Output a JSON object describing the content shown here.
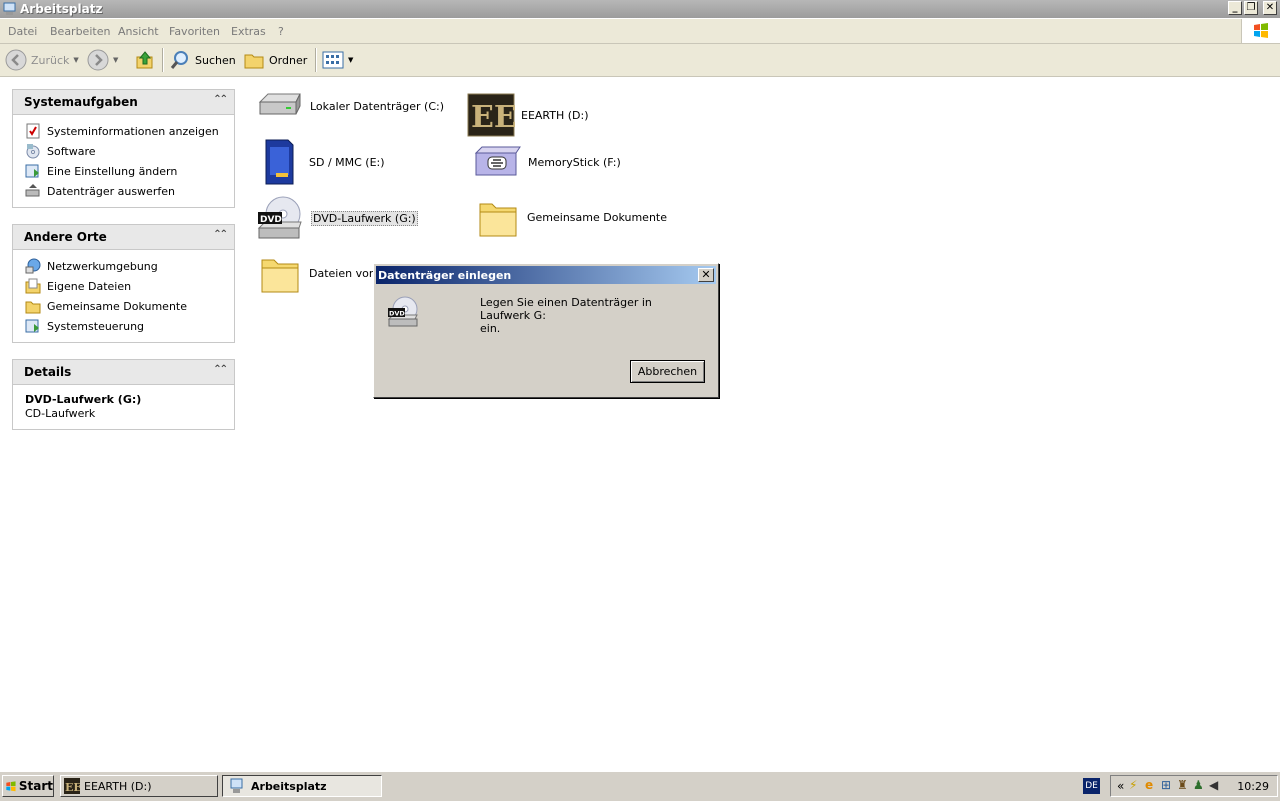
{
  "window": {
    "title": "Arbeitsplatz",
    "caption_buttons": [
      "minimize",
      "restore",
      "close"
    ]
  },
  "menubar": {
    "items": [
      "Datei",
      "Bearbeiten",
      "Ansicht",
      "Favoriten",
      "Extras",
      "?"
    ]
  },
  "toolbar": {
    "back_label": "Zurück",
    "search_label": "Suchen",
    "folders_label": "Ordner"
  },
  "left_pane": {
    "system_tasks": {
      "title": "Systemaufgaben",
      "items": [
        "Systeminformationen anzeigen",
        "Software",
        "Eine Einstellung ändern",
        "Datenträger auswerfen"
      ]
    },
    "other_places": {
      "title": "Andere Orte",
      "items": [
        "Netzwerkumgebung",
        "Eigene Dateien",
        "Gemeinsame Dokumente",
        "Systemsteuerung"
      ]
    },
    "details": {
      "title": "Details",
      "name": "DVD-Laufwerk (G:)",
      "type": "CD-Laufwerk"
    }
  },
  "drives": {
    "c": "Lokaler Datenträger (C:)",
    "d": "EEARTH (D:)",
    "e": "SD / MMC (E:)",
    "f": "MemoryStick (F:)",
    "g": "DVD-Laufwerk (G:)",
    "shared": "Gemeinsame Dokumente",
    "files_of": "Dateien von s"
  },
  "dialog": {
    "title": "Datenträger einlegen",
    "message_line1": "Legen Sie einen Datenträger in Laufwerk G:",
    "message_line2": "ein.",
    "cancel_label": "Abbrechen"
  },
  "taskbar": {
    "start_label": "Start",
    "tasks": [
      "EEARTH (D:)",
      "Arbeitsplatz"
    ],
    "active_task": "Arbeitsplatz",
    "language": "DE",
    "clock": "10:29",
    "tray_expand": "«"
  },
  "colors": {
    "dialog_title_start": "#0a246a",
    "dialog_title_end": "#a6caf0",
    "panel_header": "#e8e8e8",
    "chrome": "#ece9d8"
  }
}
